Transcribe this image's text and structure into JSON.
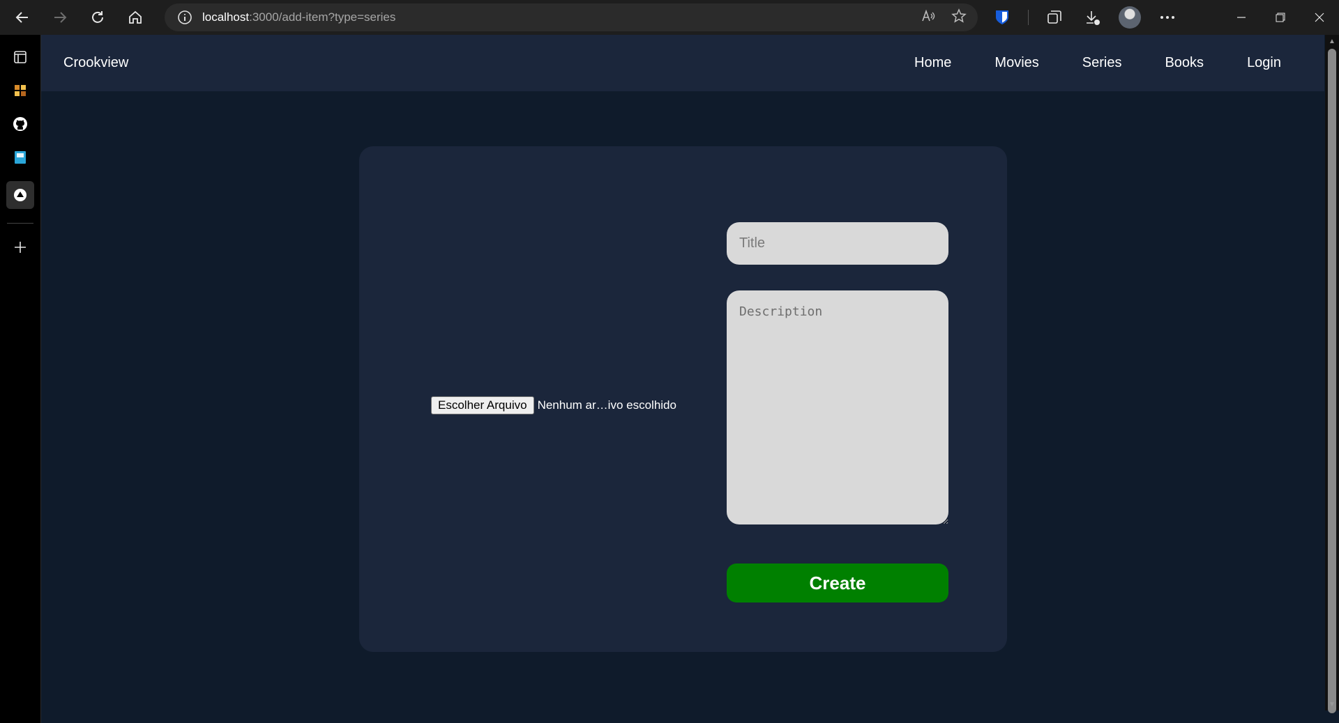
{
  "browser": {
    "url_host": "localhost",
    "url_path": ":3000/add-item?type=series"
  },
  "app": {
    "brand": "Crookview",
    "nav": [
      "Home",
      "Movies",
      "Series",
      "Books",
      "Login"
    ]
  },
  "form": {
    "file_button_label": "Escolher Arquivo",
    "file_status": "Nenhum ar…ivo escolhido",
    "title_placeholder": "Title",
    "description_placeholder": "Description",
    "submit_label": "Create"
  },
  "colors": {
    "page_background": "#0f1b2b",
    "card_background": "#1b263b",
    "create_button": "#008000",
    "input_background": "#d9d9d9"
  }
}
